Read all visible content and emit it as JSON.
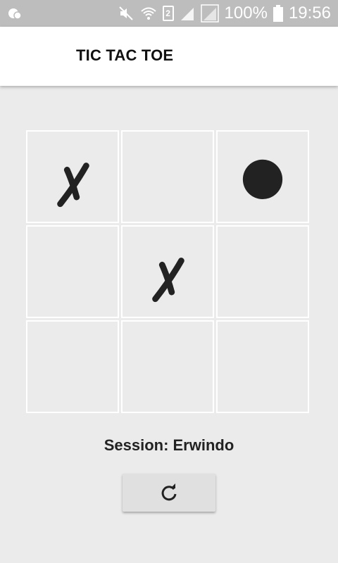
{
  "status_bar": {
    "battery_percent": "100%",
    "time": "19:56",
    "sim_slot": "2"
  },
  "app_bar": {
    "title": "TIC TAC TOE"
  },
  "board": {
    "cells": [
      "X",
      "",
      "O",
      "",
      "X",
      "",
      "",
      "",
      ""
    ]
  },
  "session": {
    "text": "Session: Erwindo"
  },
  "reload_button": {
    "icon": "refresh-icon"
  },
  "colors": {
    "background": "#ebebeb",
    "status_bar": "#bdbdbd",
    "app_bar": "#ffffff",
    "mark": "#222222",
    "grid_line": "#ffffff",
    "button": "#e0e0e0"
  }
}
